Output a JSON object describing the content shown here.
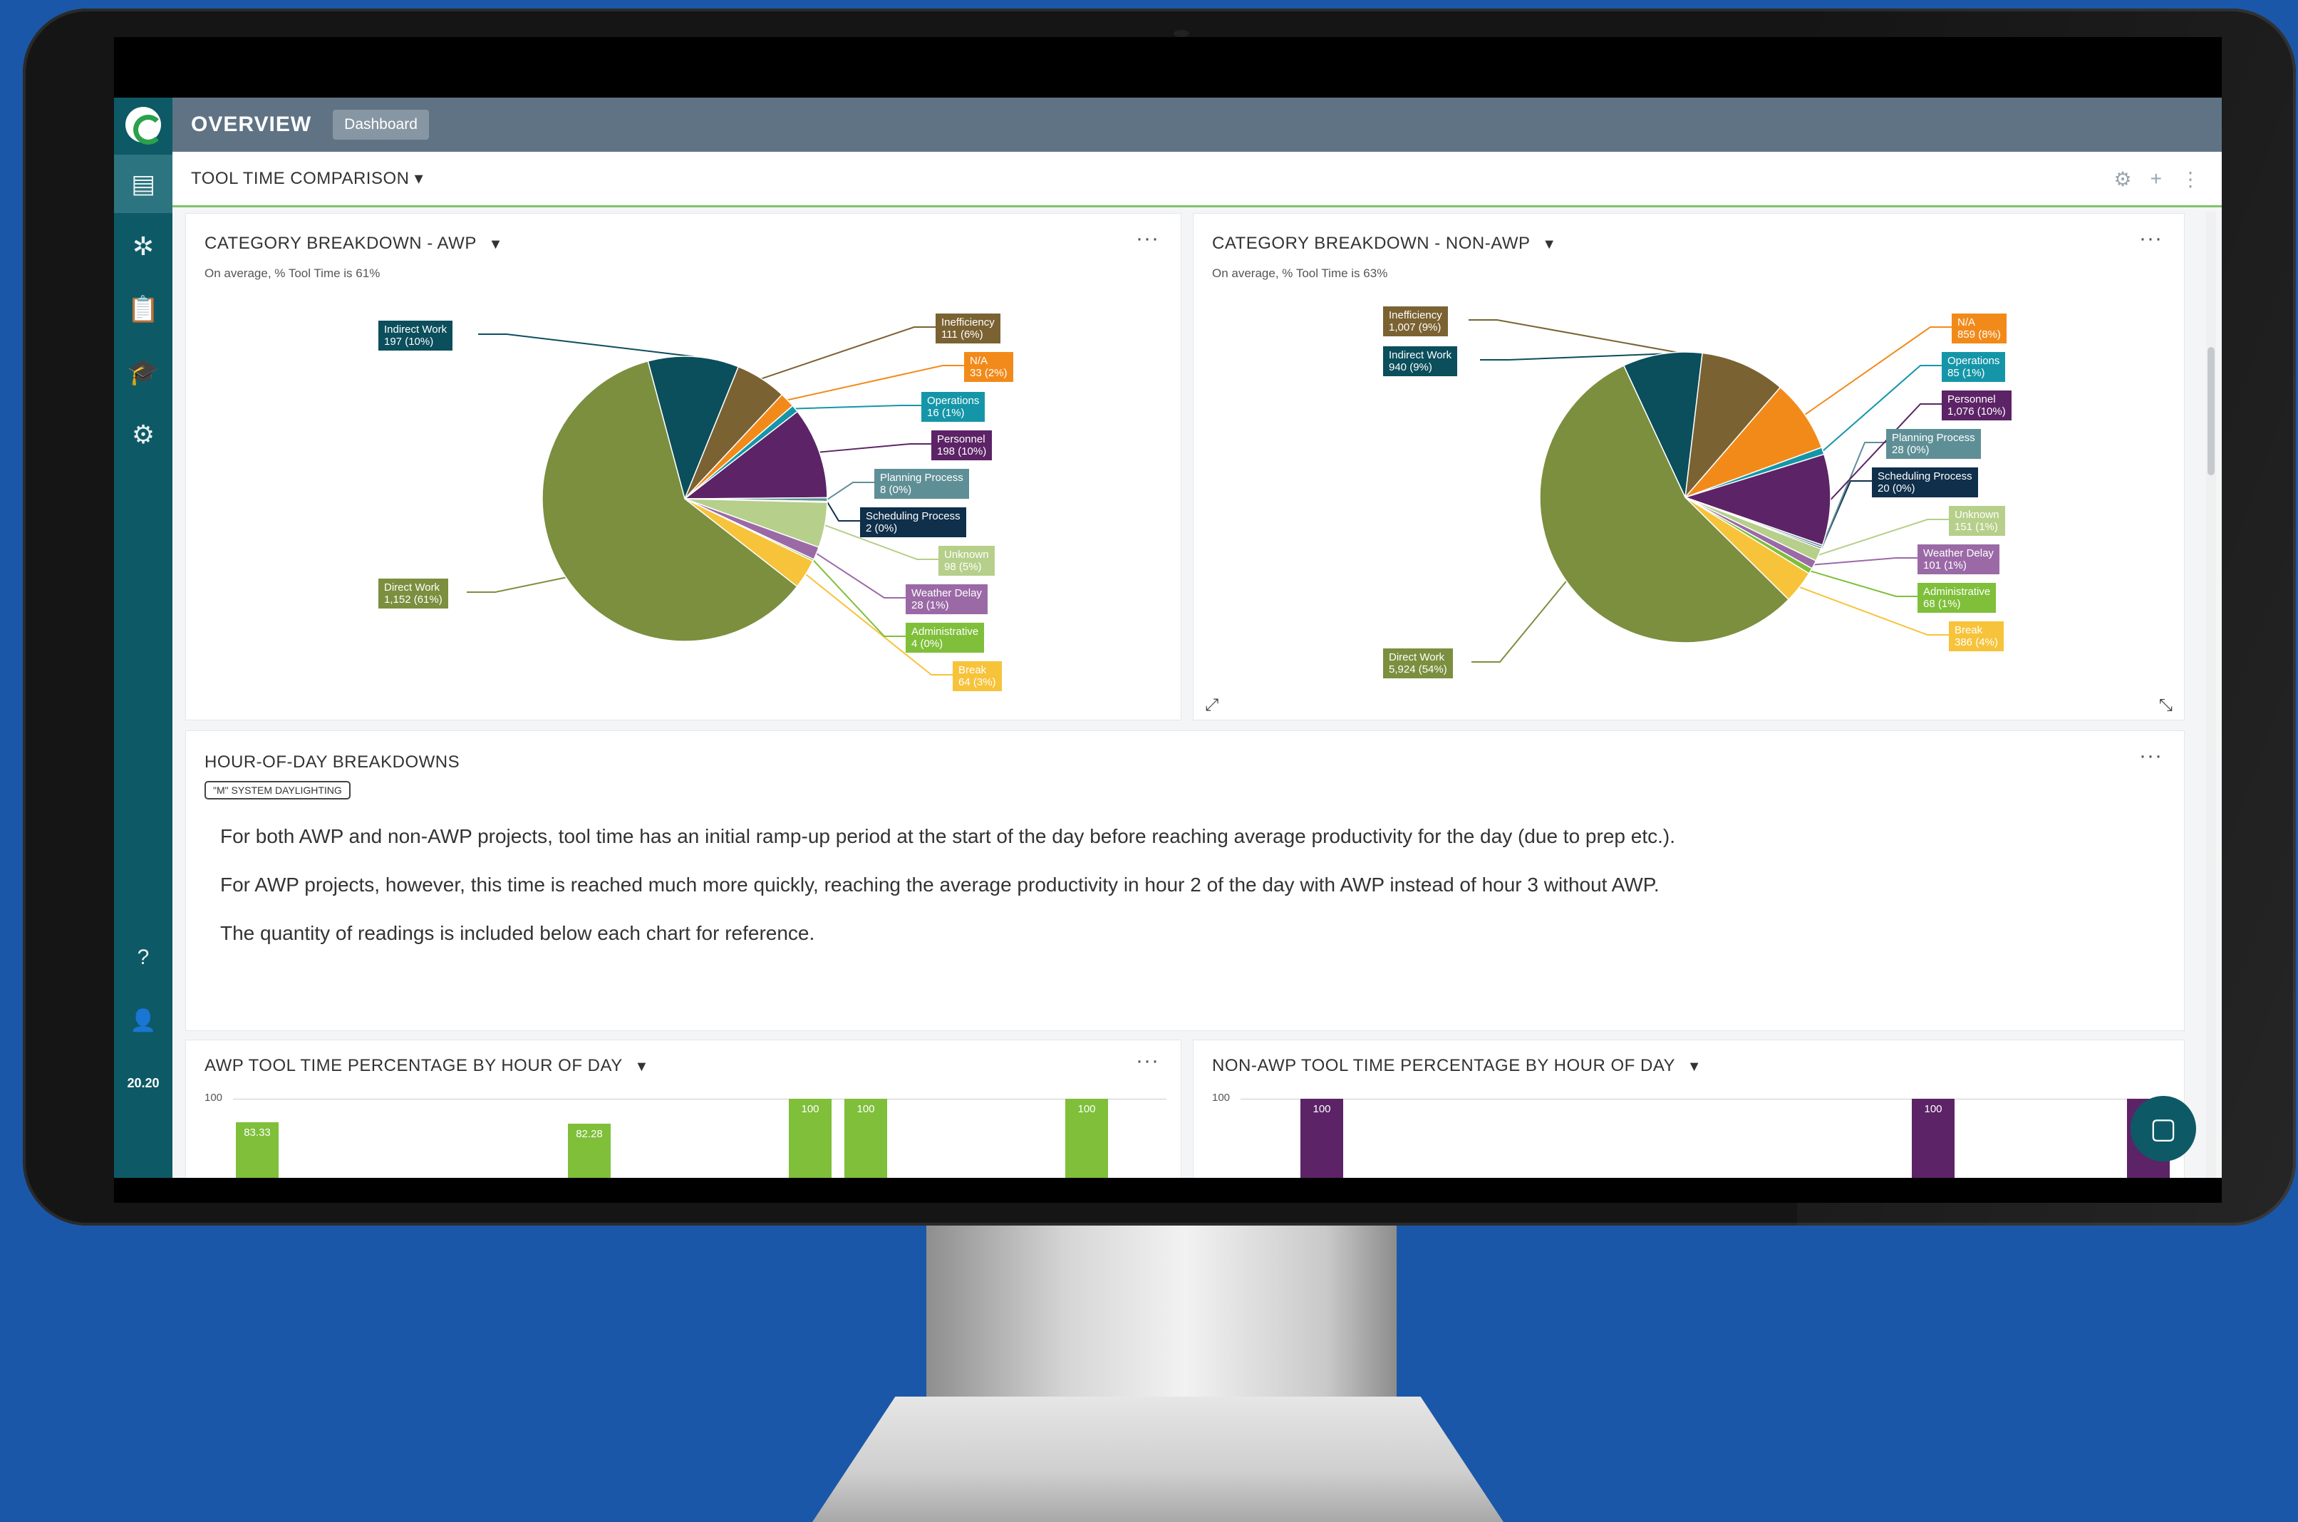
{
  "header": {
    "title": "OVERVIEW",
    "breadcrumb": "Dashboard"
  },
  "sidebar": {
    "items": [
      {
        "icon": "dashboard-icon"
      },
      {
        "icon": "network-icon"
      },
      {
        "icon": "clipboard-icon"
      },
      {
        "icon": "graduation-cap-icon"
      },
      {
        "icon": "gear-icon"
      }
    ],
    "bottom": [
      {
        "icon": "help-icon"
      },
      {
        "icon": "user-icon"
      }
    ],
    "version": "20.20"
  },
  "subbar": {
    "title": "TOOL TIME COMPARISON",
    "dropdown_glyph": "▾",
    "icons": [
      "gear-icon",
      "plus-icon",
      "more-vertical-icon"
    ]
  },
  "panels": {
    "awp": {
      "title": "CATEGORY BREAKDOWN - AWP",
      "subtitle": "On average, % Tool Time is 61%",
      "menu": "···"
    },
    "nonawp": {
      "title": "CATEGORY BREAKDOWN - NON-AWP",
      "subtitle": "On average, % Tool Time is 63%",
      "menu": "···"
    },
    "hour": {
      "title": "HOUR-OF-DAY BREAKDOWNS",
      "tag": "\"M\" SYSTEM DAYLIGHTING",
      "menu": "···",
      "notes": [
        "For both AWP and non-AWP projects, tool time has an initial ramp-up period at the start of the day before reaching average productivity for the day (due to prep etc.).",
        "For AWP projects, however, this time is reached much more quickly, reaching the average productivity in hour 2 of the day with AWP instead of hour 3 without AWP.",
        "The quantity of readings is included below each chart for reference."
      ]
    },
    "awp_hour": {
      "title": "AWP TOOL TIME PERCENTAGE BY HOUR OF DAY",
      "menu": "···",
      "ytick": "100"
    },
    "nonawp_hour": {
      "title": "NON-AWP TOOL TIME PERCENTAGE BY HOUR OF DAY",
      "ytick": "100"
    }
  },
  "colors": {
    "direct_work": "#7b8f3f",
    "indirect_work": "#0b4e5c",
    "inefficiency": "#7a6232",
    "na": "#f28a1a",
    "operations": "#1596a8",
    "personnel": "#5c2366",
    "planning": "#5f8f96",
    "scheduling": "#0f2f4a",
    "unknown": "#b6cf8a",
    "weather": "#9b6aa6",
    "administrative": "#7fbf3a",
    "break": "#f6c33a",
    "green_bar": "#7fbf3a",
    "purple_bar": "#5c2366"
  },
  "chart_data": [
    {
      "type": "pie",
      "title": "CATEGORY BREAKDOWN - AWP",
      "slices": [
        {
          "label": "Direct Work",
          "display": "1,152 (61%)",
          "value": 1152
        },
        {
          "label": "Indirect Work",
          "display": "197 (10%)",
          "value": 197
        },
        {
          "label": "Inefficiency",
          "display": "111 (6%)",
          "value": 111
        },
        {
          "label": "N/A",
          "display": "33 (2%)",
          "value": 33
        },
        {
          "label": "Operations",
          "display": "16 (1%)",
          "value": 16
        },
        {
          "label": "Personnel",
          "display": "198 (10%)",
          "value": 198
        },
        {
          "label": "Planning Process",
          "display": "8 (0%)",
          "value": 8
        },
        {
          "label": "Scheduling Process",
          "display": "2 (0%)",
          "value": 2
        },
        {
          "label": "Unknown",
          "display": "98 (5%)",
          "value": 98
        },
        {
          "label": "Weather Delay",
          "display": "28 (1%)",
          "value": 28
        },
        {
          "label": "Administrative",
          "display": "4 (0%)",
          "value": 4
        },
        {
          "label": "Break",
          "display": "64 (3%)",
          "value": 64
        }
      ]
    },
    {
      "type": "pie",
      "title": "CATEGORY BREAKDOWN - NON-AWP",
      "slices": [
        {
          "label": "Direct Work",
          "display": "5,924 (54%)",
          "value": 5924
        },
        {
          "label": "Indirect Work",
          "display": "940 (9%)",
          "value": 940
        },
        {
          "label": "Inefficiency",
          "display": "1,007 (9%)",
          "value": 1007
        },
        {
          "label": "N/A",
          "display": "859 (8%)",
          "value": 859
        },
        {
          "label": "Operations",
          "display": "85 (1%)",
          "value": 85
        },
        {
          "label": "Personnel",
          "display": "1,076 (10%)",
          "value": 1076
        },
        {
          "label": "Planning Process",
          "display": "28 (0%)",
          "value": 28
        },
        {
          "label": "Scheduling Process",
          "display": "20 (0%)",
          "value": 20
        },
        {
          "label": "Unknown",
          "display": "151 (1%)",
          "value": 151
        },
        {
          "label": "Weather Delay",
          "display": "101 (1%)",
          "value": 101
        },
        {
          "label": "Administrative",
          "display": "68 (1%)",
          "value": 68
        },
        {
          "label": "Break",
          "display": "386 (4%)",
          "value": 386
        }
      ]
    },
    {
      "type": "bar",
      "title": "AWP TOOL TIME PERCENTAGE BY HOUR OF DAY",
      "ylim": [
        0,
        100
      ],
      "visible_labels": [
        "83.33",
        "82.28",
        "100",
        "100",
        "100"
      ]
    },
    {
      "type": "bar",
      "title": "NON-AWP TOOL TIME PERCENTAGE BY HOUR OF DAY",
      "ylim": [
        0,
        100
      ],
      "visible_labels": [
        "100",
        "100",
        "100"
      ]
    }
  ]
}
